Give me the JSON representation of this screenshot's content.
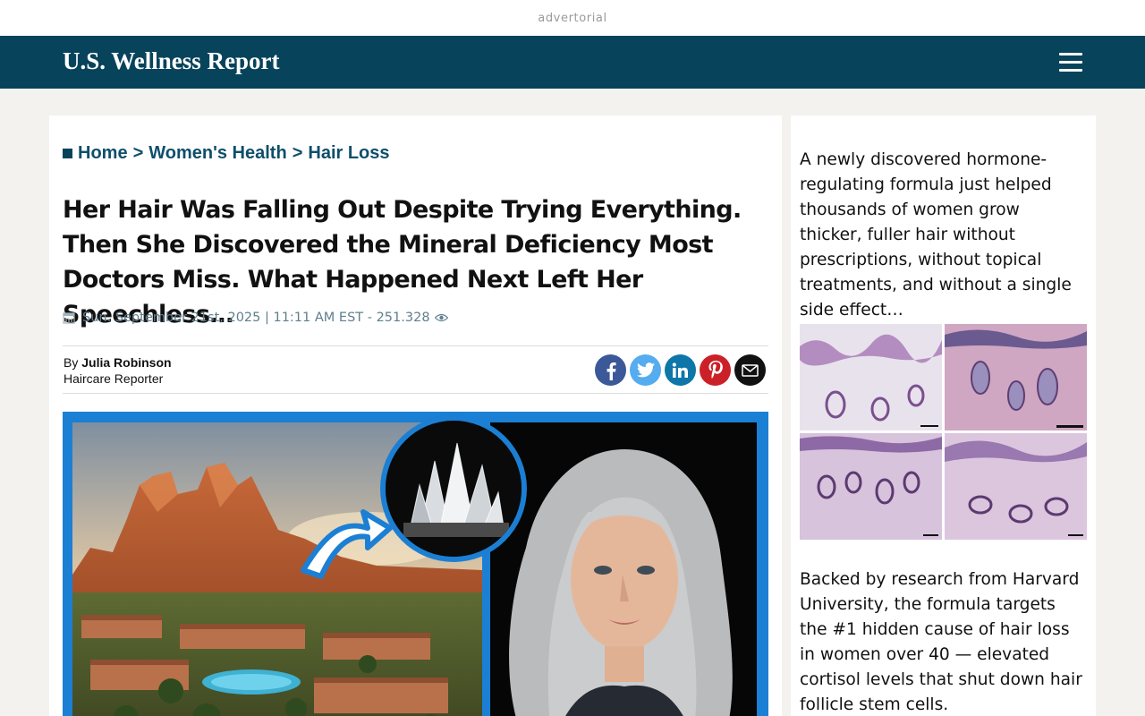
{
  "adbar": {
    "label": "advertorial"
  },
  "header": {
    "brand": "U.S. Wellness Report",
    "menu_icon": "hamburger-menu-icon"
  },
  "breadcrumb": {
    "items": [
      "Home",
      "Women's Health",
      "Hair Loss"
    ],
    "separator": ">"
  },
  "article": {
    "headline": "Her Hair Was Falling Out Despite Trying Everything. Then She Discovered the Mineral Deficiency Most Doctors Miss. What Happened Next Left Her Speechless…",
    "dateline": "Sun. September 21st, 2025 | 11:11 AM EST - 251.328",
    "author_prefix": "By",
    "author_name": "Julia Robinson",
    "author_role": "Haircare Reporter",
    "share": [
      {
        "name": "facebook",
        "icon": "facebook-icon",
        "color": "#3b5998"
      },
      {
        "name": "twitter",
        "icon": "twitter-icon",
        "color": "#55acee"
      },
      {
        "name": "linkedin",
        "icon": "linkedin-icon",
        "color": "#0e76a8"
      },
      {
        "name": "pinterest",
        "icon": "pinterest-icon",
        "color": "#cb2027"
      },
      {
        "name": "email",
        "icon": "email-icon",
        "color": "#111111"
      }
    ]
  },
  "sidebar": {
    "paragraph1": "A newly discovered hormone-regulating formula just helped thousands of women grow thicker, fuller hair without prescriptions, without topical treatments, and without a single side effect…",
    "paragraph2": "Backed by research from Harvard University, the formula targets the #1 hidden cause of hair loss in women over 40 — elevated cortisol levels that shut down hair follicle stem cells."
  },
  "colors": {
    "header_bg": "#07435b",
    "accent_link": "#0e4f6b",
    "hero_frame": "#1b7fd4",
    "page_bg": "#f3f2ef"
  }
}
